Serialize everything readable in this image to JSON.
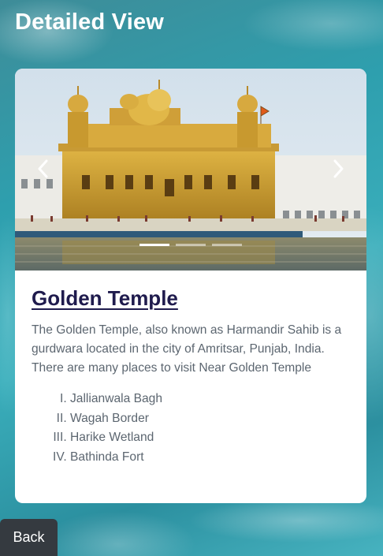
{
  "header": {
    "title": "Detailed View"
  },
  "card": {
    "title": "Golden Temple",
    "description": "The Golden Temple, also known as Harmandir Sahib is a gurdwara located in the city of Amritsar, Punjab, India. There are many places to visit Near Golden Temple",
    "places": [
      "Jallianwala Bagh",
      "Wagah Border",
      "Harike Wetland",
      "Bathinda Fort"
    ]
  },
  "carousel": {
    "slide_count": 3,
    "active_index": 0,
    "image_subject": "golden-temple-photo"
  },
  "footer": {
    "back_label": "Back"
  },
  "colors": {
    "title": "#1f1b4d",
    "back_button": "#353a40",
    "text": "#5c6670"
  }
}
